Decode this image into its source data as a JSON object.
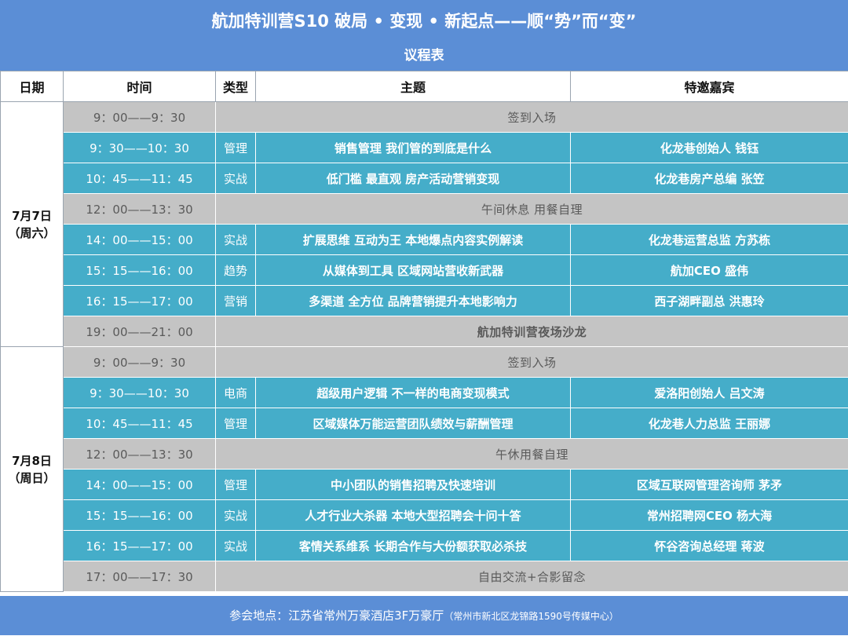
{
  "header": {
    "title": "航加特训营S10  破局 • 变现 • 新起点——顺“势”而“变”",
    "subtitle": "议程表"
  },
  "columns": [
    "日期",
    "时间",
    "类型",
    "主题",
    "特邀嘉宾"
  ],
  "days": [
    {
      "date": "7月7日",
      "weekday": "（周六）",
      "rows": [
        {
          "time": "9：00——9：30",
          "type": "",
          "topic": "签到入场",
          "guest": "",
          "span": true,
          "bold": false
        },
        {
          "time": "9：30——10：30",
          "type": "管理",
          "topic": "销售管理 我们管的到底是什么",
          "guest": "化龙巷创始人 钱钰",
          "span": false
        },
        {
          "time": "10：45——11：45",
          "type": "实战",
          "topic": "低门槛 最直观 房产活动营销变现",
          "guest": "化龙巷房产总编 张笠",
          "span": false
        },
        {
          "time": "12：00——13：30",
          "type": "",
          "topic": "午间休息      用餐自理",
          "guest": "",
          "span": true,
          "bold": false
        },
        {
          "time": "14：00——15：00",
          "type": "实战",
          "topic": "扩展思维 互动为王 本地爆点内容实例解读",
          "guest": "化龙巷运营总监  方苏栋",
          "span": false
        },
        {
          "time": "15：15——16：00",
          "type": "趋势",
          "topic": "从媒体到工具 区域网站营收新武器",
          "guest": "航加CEO  盛伟",
          "span": false
        },
        {
          "time": "16：15——17：00",
          "type": "营销",
          "topic": "多渠道  全方位  品牌营销提升本地影响力",
          "guest": "西子湖畔副总 洪惠玲",
          "span": false
        },
        {
          "time": "19：00——21：00",
          "type": "",
          "topic": "航加特训营夜场沙龙",
          "guest": "",
          "span": true,
          "bold": true
        }
      ]
    },
    {
      "date": "7月8日",
      "weekday": "（周日）",
      "rows": [
        {
          "time": "9：00——9：30",
          "type": "",
          "topic": "签到入场",
          "guest": "",
          "span": true,
          "bold": false
        },
        {
          "time": "9：30——10：30",
          "type": "电商",
          "topic": "超级用户逻辑 不一样的电商变现模式",
          "guest": "爱洛阳创始人 吕文涛",
          "span": false
        },
        {
          "time": "10：45——11：45",
          "type": "管理",
          "topic": "区域媒体万能运营团队绩效与薪酬管理",
          "guest": "化龙巷人力总监 王丽娜",
          "span": false
        },
        {
          "time": "12：00——13：30",
          "type": "",
          "topic": "午休用餐自理",
          "guest": "",
          "span": true,
          "bold": false
        },
        {
          "time": "14：00——15：00",
          "type": "管理",
          "topic": "中小团队的销售招聘及快速培训",
          "guest": "区域互联网管理咨询师 茅矛",
          "span": false
        },
        {
          "time": "15：15——16：00",
          "type": "实战",
          "topic": "人才行业大杀器 本地大型招聘会十问十答",
          "guest": "常州招聘网CEO 杨大海",
          "span": false
        },
        {
          "time": "16：15——17：00",
          "type": "实战",
          "topic": "客情关系维系 长期合作与大份额获取必杀技",
          "guest": "怀谷咨询总经理 蒋波",
          "span": false
        },
        {
          "time": "17：00——17：30",
          "type": "",
          "topic": "自由交流+合影留念",
          "guest": "",
          "span": true,
          "bold": false
        }
      ]
    }
  ],
  "footer": {
    "venue": "参会地点：江苏省常州万豪酒店3F万豪厅",
    "address": "（常州市新北区龙锦路1590号传媒中心）"
  },
  "colors": {
    "header_bg": "#5b8ed6",
    "session_row": "#45adc9",
    "break_row": "#c4c4c4"
  }
}
